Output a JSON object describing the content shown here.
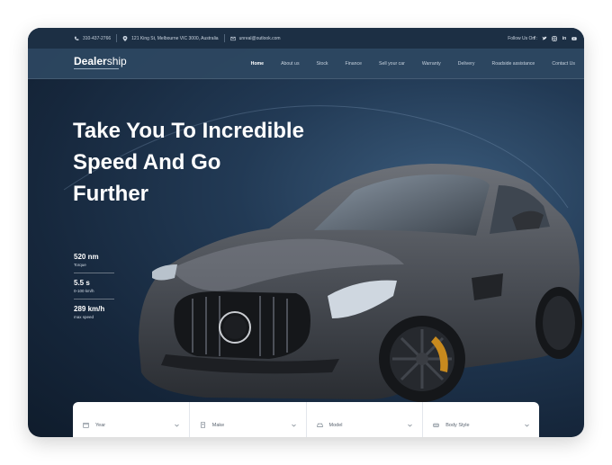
{
  "topbar": {
    "phone": "310-437-2766",
    "address": "121 King St, Melbourne VIC 3000, Australia",
    "email": "unreal@outlook.com",
    "follow_label": "Follow Us On :",
    "socials": [
      "facebook-icon",
      "twitter-icon",
      "instagram-icon",
      "linkedin-icon",
      "youtube-icon"
    ]
  },
  "navbar": {
    "logo_bold": "Dealer",
    "logo_light": "ship",
    "items": [
      "Home",
      "About us",
      "Stock",
      "Finance",
      "Sell your car",
      "Warranty",
      "Delivery",
      "Roadside assistance",
      "Contact Us"
    ],
    "active": "Home"
  },
  "hero": {
    "headline": [
      "Take You To Incredible",
      "Speed And Go",
      "Further"
    ],
    "stats": [
      {
        "value": "520 nm",
        "label": "Torque"
      },
      {
        "value": "5.5 s",
        "label": "0-100 km/h"
      },
      {
        "value": "289 km/h",
        "label": "max speed"
      }
    ]
  },
  "search": {
    "fields": [
      {
        "label": "Year",
        "icon": "calendar-icon"
      },
      {
        "label": "Make",
        "icon": "tag-icon"
      },
      {
        "label": "Model",
        "icon": "car-icon"
      },
      {
        "label": "Body Style",
        "icon": "car-body-icon"
      }
    ]
  },
  "colors": {
    "accent_dark": "#16273c",
    "nav_bg": "#2e4862",
    "text_light": "#ffffff"
  }
}
